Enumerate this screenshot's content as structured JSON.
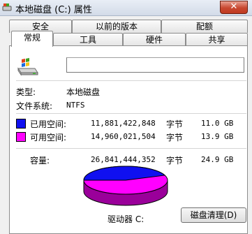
{
  "window": {
    "title": "本地磁盘 (C:) 属性",
    "close_label": "✕"
  },
  "tabs": {
    "row1": [
      "安全",
      "以前的版本",
      "配额"
    ],
    "row2": [
      "常规",
      "工具",
      "硬件",
      "共享"
    ],
    "active": "常规"
  },
  "general": {
    "name_value": "",
    "type_label": "类型:",
    "type_value": "本地磁盘",
    "fs_label": "文件系统:",
    "fs_value": "NTFS",
    "used": {
      "label": "已用空间:",
      "bytes": "11,881,422,848",
      "unit": "字节",
      "size": "11.0 GB",
      "color": "#1010f0"
    },
    "free": {
      "label": "可用空间:",
      "bytes": "14,960,021,504",
      "unit": "字节",
      "size": "13.9 GB",
      "color": "#ff00ff"
    },
    "capacity": {
      "label": "容量:",
      "bytes": "26,841,444,352",
      "unit": "字节",
      "size": "24.9 GB"
    },
    "drive_label": "驱动器 C:",
    "cleanup_button": "磁盘清理(D)",
    "used_fraction": 0.4426
  }
}
